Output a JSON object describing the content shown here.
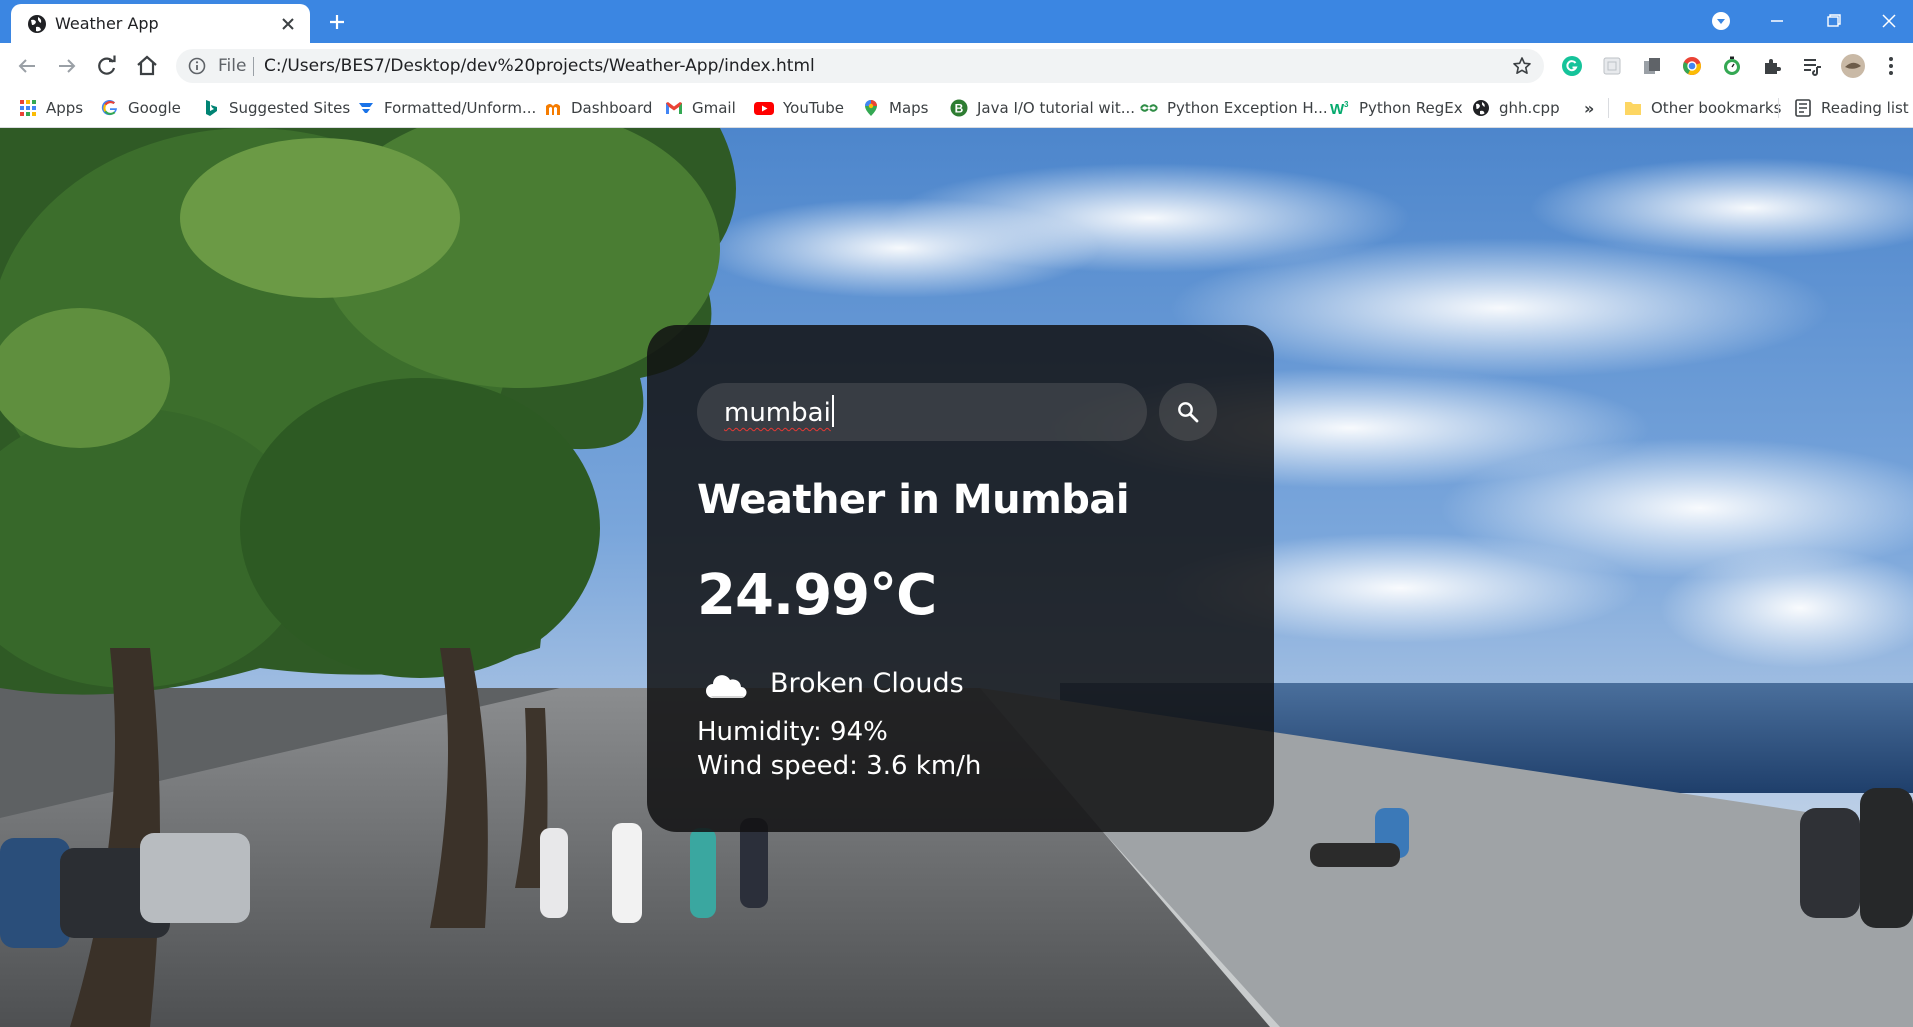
{
  "browser": {
    "tab_title": "Weather App",
    "address": {
      "scheme_label": "File",
      "url": "C:/Users/BES7/Desktop/dev%20projects/Weather-App/index.html"
    },
    "bookmarks": [
      {
        "label": "Apps",
        "icon": "apps-grid-icon"
      },
      {
        "label": "Google",
        "icon": "google-icon"
      },
      {
        "label": "Suggested Sites",
        "icon": "bing-icon"
      },
      {
        "label": "Formatted/Unform...",
        "icon": "bookmark-icon"
      },
      {
        "label": "Dashboard",
        "icon": "dashboard-icon"
      },
      {
        "label": "Gmail",
        "icon": "gmail-icon"
      },
      {
        "label": "YouTube",
        "icon": "youtube-icon"
      },
      {
        "label": "Maps",
        "icon": "maps-pin-icon"
      },
      {
        "label": "Java I/O tutorial wit...",
        "icon": "java-icon"
      },
      {
        "label": "Python Exception H...",
        "icon": "gfg-icon"
      },
      {
        "label": "Python RegEx",
        "icon": "w3schools-icon"
      },
      {
        "label": "ghh.cpp",
        "icon": "globe-icon"
      }
    ],
    "overflow_label": "»",
    "other_bookmarks": "Other bookmarks",
    "reading_list": "Reading list"
  },
  "weather": {
    "search_value": "mumbai",
    "heading": "Weather in Mumbai",
    "temperature": "24.99°C",
    "description": "Broken Clouds",
    "humidity": "Humidity: 94%",
    "wind": "Wind speed: 3.6 km/h"
  },
  "colors": {
    "tabstrip": "#3b86e2",
    "card": "#111113",
    "text": "#ffffff"
  }
}
